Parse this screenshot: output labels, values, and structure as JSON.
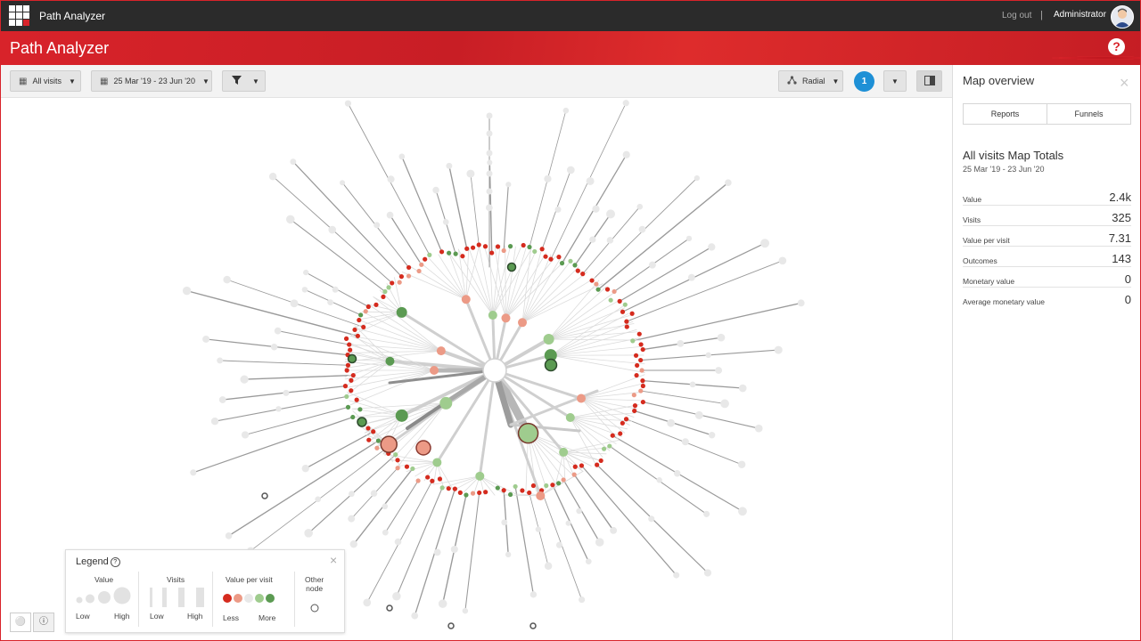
{
  "topbar": {
    "app_name": "Path Analyzer",
    "logout": "Log out",
    "separator": "|",
    "user": "Administrator"
  },
  "header": {
    "title": "Path Analyzer",
    "help_icon": "question-circle"
  },
  "toolbar": {
    "segment_label": "All visits",
    "date_range": "25 Mar '19 - 23 Jun '20",
    "layout_label": "Radial",
    "count_badge": "1"
  },
  "panel": {
    "title": "Map overview",
    "tabs": [
      "Reports",
      "Funnels"
    ],
    "totals_title": "All visits Map Totals",
    "totals_range": "25 Mar '19 - 23 Jun '20",
    "metrics": [
      {
        "label": "Value",
        "value": "2.4k"
      },
      {
        "label": "Visits",
        "value": "325"
      },
      {
        "label": "Value per visit",
        "value": "7.31"
      },
      {
        "label": "Outcomes",
        "value": "143"
      },
      {
        "label": "Monetary value",
        "value": "0"
      },
      {
        "label": "Average monetary value",
        "value": "0"
      }
    ]
  },
  "legend": {
    "title": "Legend",
    "value_label": "Value",
    "visits_label": "Visits",
    "vpv_label": "Value per visit",
    "other_label_1": "Other",
    "other_label_2": "node",
    "low": "Low",
    "high": "High",
    "less": "Less",
    "more": "More"
  },
  "colors": {
    "brand_red": "#d8232a",
    "dark_red": "#d52b1e",
    "light_red": "#ec9a86",
    "neutral": "#e8e8e8",
    "light_green": "#9fcc8e",
    "dark_green": "#5b9a52",
    "badge_blue": "#1e90d6"
  }
}
